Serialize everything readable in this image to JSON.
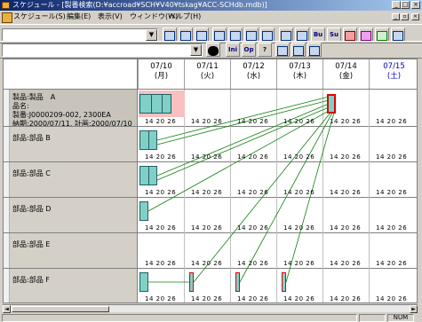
{
  "window": {
    "title": "スケジュール - [製番検索(D:¥accroad¥SCH¥V40¥tskag¥ACC-SCHdb.mdb)]",
    "controls": {
      "minimize": "_",
      "maximize": "□",
      "close": "×"
    },
    "doc_controls": {
      "minimize": "_",
      "restore": "▫",
      "close": "×"
    }
  },
  "menu": [
    {
      "label": "スケジュール(S)"
    },
    {
      "label": "編集(E)"
    },
    {
      "label": "表示(V)"
    },
    {
      "label": "ウィンドウ(W)"
    },
    {
      "label": "ヘルプ(H)"
    }
  ],
  "toolbar": {
    "combo1_value": "",
    "combo2_value": "",
    "btn_ini": "Ini",
    "btn_op": "Op",
    "btn_ba": "Bu",
    "btn_su": "Su",
    "btn_help": "?"
  },
  "days": [
    {
      "date": "07/10",
      "dow": "(月)"
    },
    {
      "date": "07/11",
      "dow": "(火)"
    },
    {
      "date": "07/12",
      "dow": "(水)"
    },
    {
      "date": "07/13",
      "dow": "(木)"
    },
    {
      "date": "07/14",
      "dow": "(金)"
    },
    {
      "date": "07/15",
      "dow": "(土)"
    }
  ],
  "tick_label": "14  20  26",
  "rows": [
    {
      "line1": "製品:製品　A",
      "line2": "品名:",
      "line3": "製番:J0000209-002, 2300EA",
      "line4": "納期:2000/07/11, 計画:2000/07/10"
    },
    {
      "line1": "部品:部品 B"
    },
    {
      "line1": "部品:部品 C"
    },
    {
      "line1": "部品:部品 D"
    },
    {
      "line1": "部品:部品 E"
    },
    {
      "line1": "部品:部品 F"
    }
  ],
  "scroll": {
    "left": "◄",
    "right": "►"
  },
  "status": {
    "num": "NUM"
  },
  "colors": {
    "bar": "#80d0c8",
    "highlight": "#f8c0c0",
    "link": "#108010",
    "marker": "#e00000"
  }
}
